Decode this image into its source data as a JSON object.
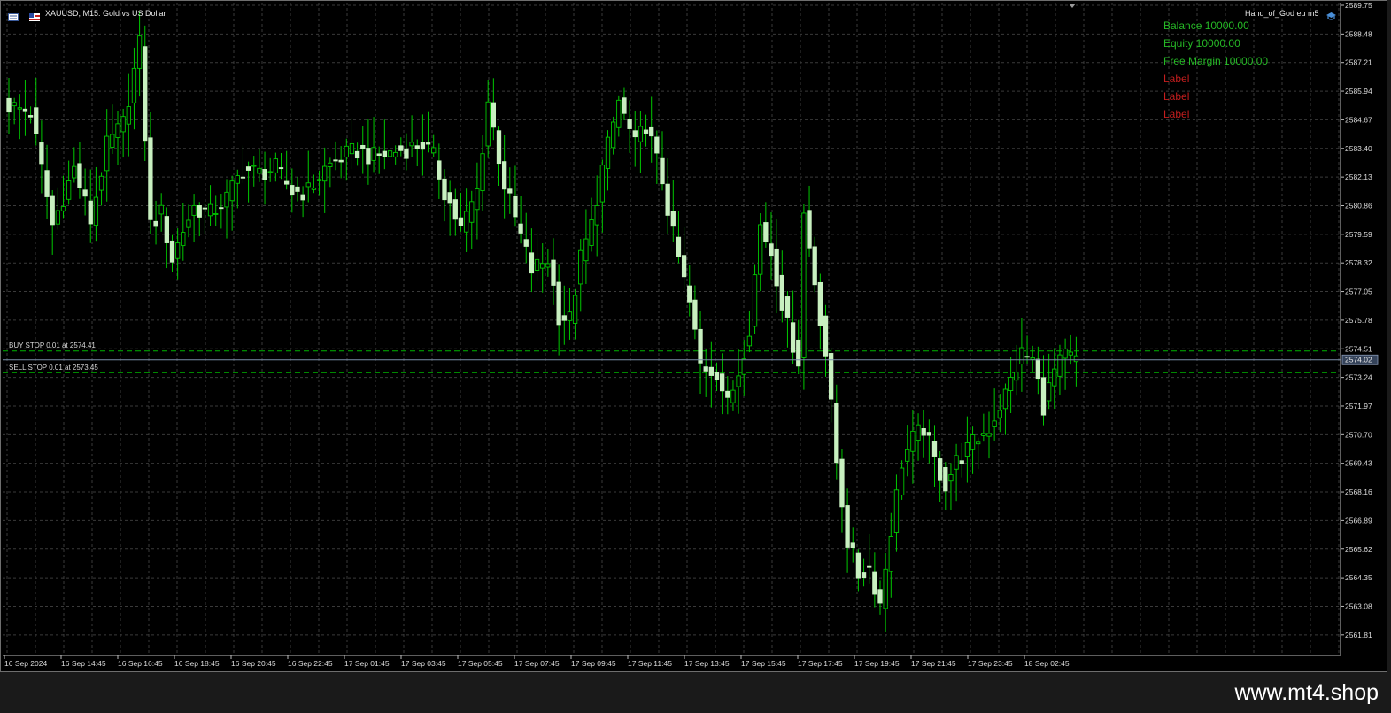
{
  "window": {
    "title": "XAUUSD, M15:  Gold vs US Dollar",
    "expert_name": "Hand_of_God eu m5"
  },
  "account_panel": {
    "balance": "Balance 10000.00",
    "equity": "Equity 10000.00",
    "free_margin": "Free Margin 10000.00",
    "labels": [
      "Label",
      "Label",
      "Label"
    ],
    "colors": {
      "values": "#26b926",
      "labels": "#c41e1e"
    }
  },
  "orders": {
    "buy_stop": {
      "text": "BUY STOP 0.01 at 2574.41",
      "price": 2574.41
    },
    "sell_stop": {
      "text": "SELL STOP 0.01 at 2573.45",
      "price": 2573.45
    }
  },
  "current_price": {
    "label": "2574.02",
    "value": 2574.02
  },
  "watermark": "www.mt4.shop",
  "colors": {
    "background": "#000000",
    "grid": "#3a3a3a",
    "candle_wick": "#00c800",
    "candle_body": "#c8f0c0",
    "price_line": "#7b8ea8",
    "axis_text": "#dcdcdc"
  },
  "icons": [
    "chart-window-icon",
    "expert-hat-icon"
  ],
  "chart_data": {
    "type": "candlestick",
    "symbol": "XAUUSD",
    "timeframe": "M15",
    "ylim": [
      2560.9,
      2589.75
    ],
    "y_ticks": [
      "2589.75",
      "2588.48",
      "2587.21",
      "2585.94",
      "2584.67",
      "2583.40",
      "2582.13",
      "2580.86",
      "2579.59",
      "2578.32",
      "2577.05",
      "2575.78",
      "2574.51",
      "2573.24",
      "2571.97",
      "2570.70",
      "2569.43",
      "2568.16",
      "2566.89",
      "2565.62",
      "2564.35",
      "2563.08",
      "2561.81"
    ],
    "x_ticks": [
      "16 Sep 2024",
      "16 Sep 14:45",
      "16 Sep 16:45",
      "16 Sep 18:45",
      "16 Sep 20:45",
      "16 Sep 22:45",
      "17 Sep 01:45",
      "17 Sep 03:45",
      "17 Sep 05:45",
      "17 Sep 07:45",
      "17 Sep 09:45",
      "17 Sep 11:45",
      "17 Sep 13:45",
      "17 Sep 15:45",
      "17 Sep 17:45",
      "17 Sep 19:45",
      "17 Sep 21:45",
      "17 Sep 23:45",
      "18 Sep 02:45"
    ],
    "close_path": [
      [
        0,
        2585.3
      ],
      [
        4,
        2585.0
      ],
      [
        8,
        2580.0
      ],
      [
        12,
        2582.5
      ],
      [
        15,
        2580.2
      ],
      [
        18,
        2583.5
      ],
      [
        21,
        2584.5
      ],
      [
        24,
        2588.0
      ],
      [
        26,
        2580.0
      ],
      [
        28,
        2580.5
      ],
      [
        30,
        2578.5
      ],
      [
        32,
        2579.8
      ],
      [
        34,
        2580.8
      ],
      [
        37,
        2580.5
      ],
      [
        40,
        2581.2
      ],
      [
        43,
        2582.5
      ],
      [
        46,
        2582.3
      ],
      [
        49,
        2582.5
      ],
      [
        52,
        2581.5
      ],
      [
        55,
        2581.5
      ],
      [
        58,
        2582.5
      ],
      [
        61,
        2583.0
      ],
      [
        64,
        2583.3
      ],
      [
        67,
        2583.0
      ],
      [
        70,
        2583.2
      ],
      [
        73,
        2583.4
      ],
      [
        76,
        2583.6
      ],
      [
        78,
        2583.0
      ],
      [
        80,
        2581.5
      ],
      [
        83,
        2579.8
      ],
      [
        86,
        2581.5
      ],
      [
        88,
        2585.5
      ],
      [
        91,
        2581.8
      ],
      [
        94,
        2579.5
      ],
      [
        96,
        2578.0
      ],
      [
        99,
        2578.5
      ],
      [
        101,
        2576.0
      ],
      [
        103,
        2575.8
      ],
      [
        105,
        2578.5
      ],
      [
        107,
        2580.0
      ],
      [
        109,
        2582.5
      ],
      [
        112,
        2585.5
      ],
      [
        115,
        2583.5
      ],
      [
        117,
        2584.5
      ],
      [
        120,
        2582.0
      ],
      [
        122,
        2579.5
      ],
      [
        125,
        2576.5
      ],
      [
        127,
        2573.8
      ],
      [
        130,
        2573.5
      ],
      [
        132,
        2572.0
      ],
      [
        134,
        2573.5
      ],
      [
        136,
        2575.5
      ],
      [
        138,
        2580.0
      ],
      [
        140,
        2578.8
      ],
      [
        143,
        2575.5
      ],
      [
        145,
        2574.0
      ],
      [
        146,
        2580.5
      ],
      [
        148,
        2577.5
      ],
      [
        150,
        2574.3
      ],
      [
        152,
        2569.5
      ],
      [
        154,
        2566.0
      ],
      [
        156,
        2564.5
      ],
      [
        158,
        2564.8
      ],
      [
        160,
        2563.2
      ],
      [
        162,
        2566.5
      ],
      [
        164,
        2569.5
      ],
      [
        166,
        2570.5
      ],
      [
        168,
        2571.0
      ],
      [
        170,
        2569.5
      ],
      [
        172,
        2568.5
      ],
      [
        174,
        2569.5
      ],
      [
        177,
        2570.3
      ],
      [
        180,
        2571.0
      ],
      [
        183,
        2572.5
      ],
      [
        186,
        2574.3
      ],
      [
        188,
        2574.0
      ],
      [
        190,
        2572.0
      ],
      [
        192,
        2573.5
      ],
      [
        194,
        2574.2
      ],
      [
        196,
        2574.0
      ]
    ]
  }
}
